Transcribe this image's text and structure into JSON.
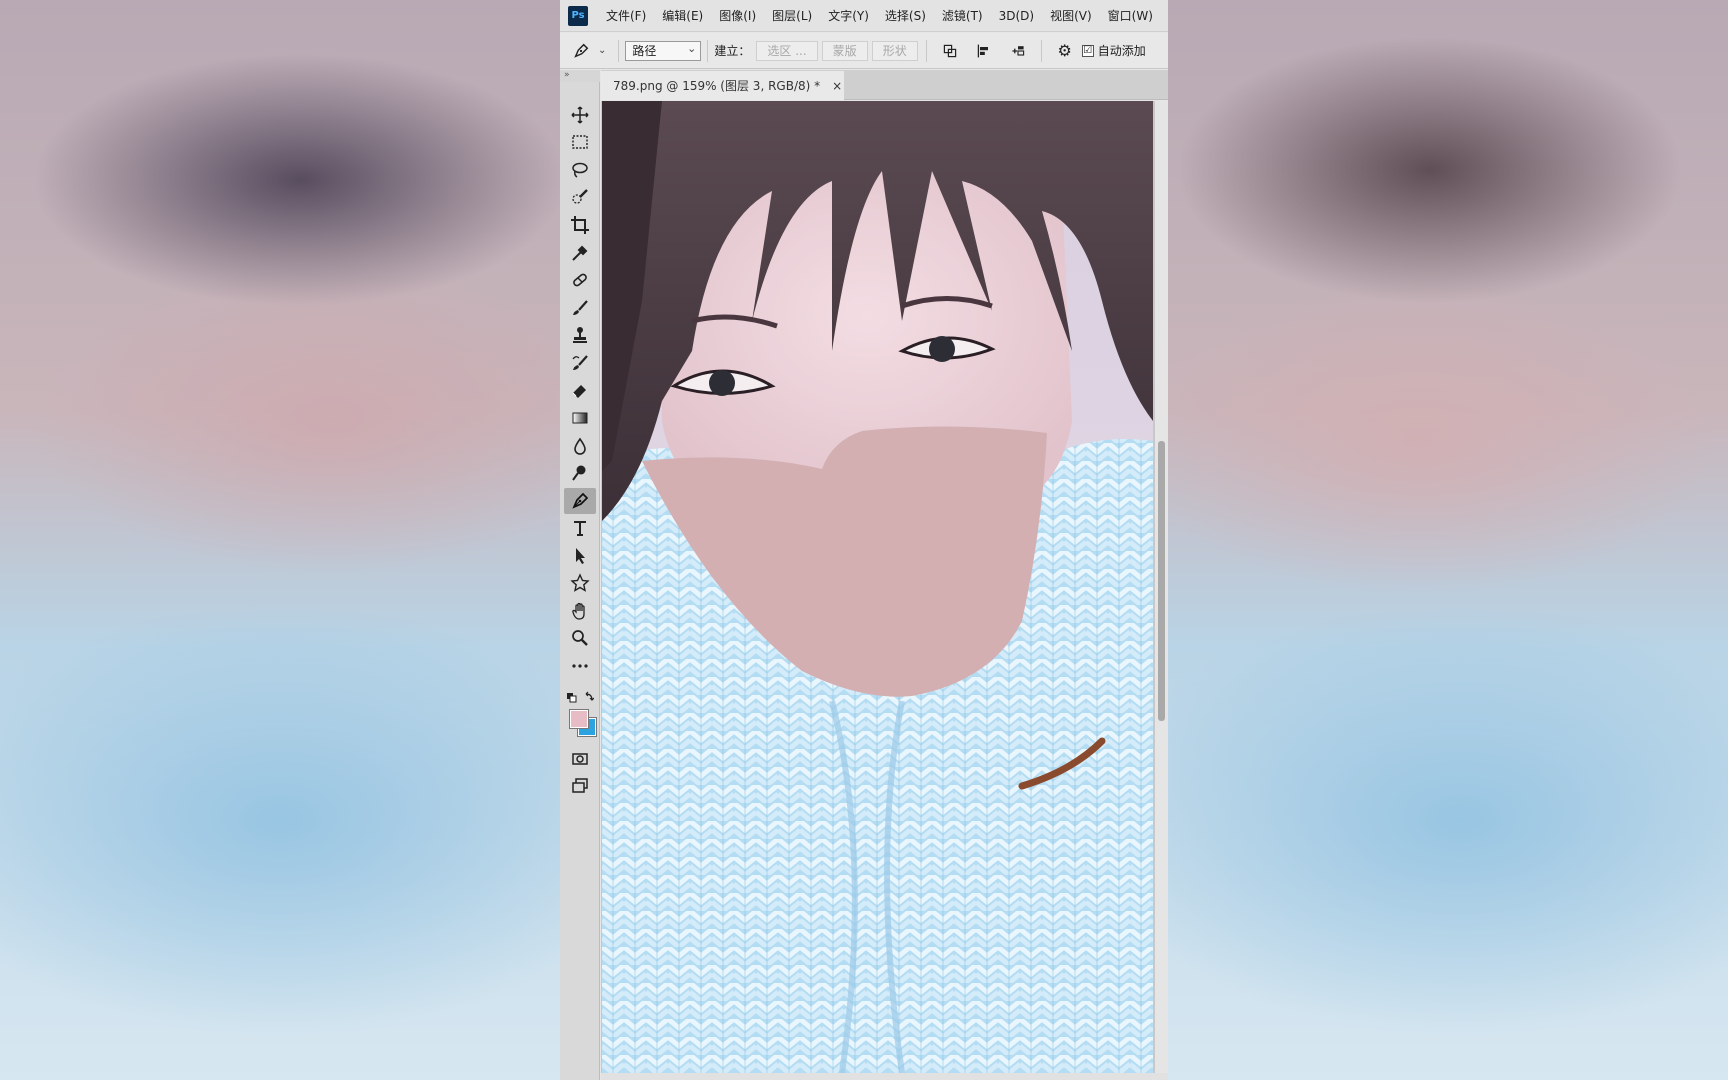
{
  "app": {
    "logo_text": "Ps",
    "menus": [
      "文件(F)",
      "编辑(E)",
      "图像(I)",
      "图层(L)",
      "文字(Y)",
      "选择(S)",
      "滤镜(T)",
      "3D(D)",
      "视图(V)",
      "窗口(W)"
    ]
  },
  "options": {
    "mode_value": "路径",
    "build_label": "建立：",
    "btn_selection": "选区 ...",
    "btn_mask": "蒙版",
    "btn_shape": "形状",
    "auto_add_label": "自动添加",
    "auto_add_checked": "☑"
  },
  "panel": {
    "collapse_glyph": "»"
  },
  "document": {
    "tab_title": "789.png @ 159% (图层 3, RGB/8) *",
    "close_glyph": "×"
  },
  "colors": {
    "foreground": "#e8bcc4",
    "background": "#2aa3e0",
    "mask_fill": "#d3afb2"
  },
  "tools": [
    {
      "name": "move-tool-icon",
      "active": false
    },
    {
      "name": "rectangle-marquee-tool-icon",
      "active": false
    },
    {
      "name": "lasso-tool-icon",
      "active": false
    },
    {
      "name": "quick-selection-tool-icon",
      "active": false
    },
    {
      "name": "crop-tool-icon",
      "active": false
    },
    {
      "name": "eyedropper-tool-icon",
      "active": false
    },
    {
      "name": "healing-brush-tool-icon",
      "active": false
    },
    {
      "name": "brush-tool-icon",
      "active": false
    },
    {
      "name": "clone-stamp-tool-icon",
      "active": false
    },
    {
      "name": "history-brush-tool-icon",
      "active": false
    },
    {
      "name": "eraser-tool-icon",
      "active": false
    },
    {
      "name": "gradient-tool-icon",
      "active": false
    },
    {
      "name": "blur-tool-icon",
      "active": false
    },
    {
      "name": "dodge-tool-icon",
      "active": false
    },
    {
      "name": "pen-tool-icon",
      "active": true
    },
    {
      "name": "type-tool-icon",
      "active": false
    },
    {
      "name": "path-selection-tool-icon",
      "active": false
    },
    {
      "name": "custom-shape-tool-icon",
      "active": false
    },
    {
      "name": "hand-tool-icon",
      "active": false
    },
    {
      "name": "zoom-tool-icon",
      "active": false
    },
    {
      "name": "more-tools-icon",
      "active": false
    }
  ]
}
